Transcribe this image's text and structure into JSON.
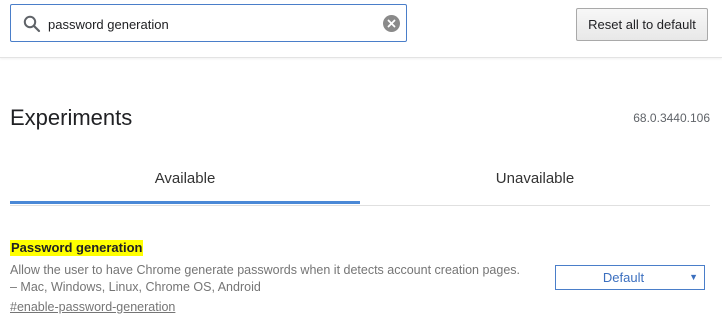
{
  "search": {
    "value": "password generation",
    "icon": "search-icon",
    "clear_icon": "clear-icon"
  },
  "header": {
    "reset_label": "Reset all to default"
  },
  "page": {
    "title": "Experiments",
    "version": "68.0.3440.106"
  },
  "tabs": [
    {
      "label": "Available",
      "selected": true
    },
    {
      "label": "Unavailable",
      "selected": false
    }
  ],
  "experiment": {
    "name": "Password generation",
    "description_line1": "Allow the user to have Chrome generate passwords when it detects account creation pages.",
    "description_line2": "– Mac, Windows, Linux, Chrome OS, Android",
    "link": "#enable-password-generation",
    "selected_option": "Default",
    "dropdown_arrow": "▼"
  },
  "colors": {
    "accent": "#4a88d6",
    "highlight": "#ffff00",
    "muted_text": "#757575"
  }
}
